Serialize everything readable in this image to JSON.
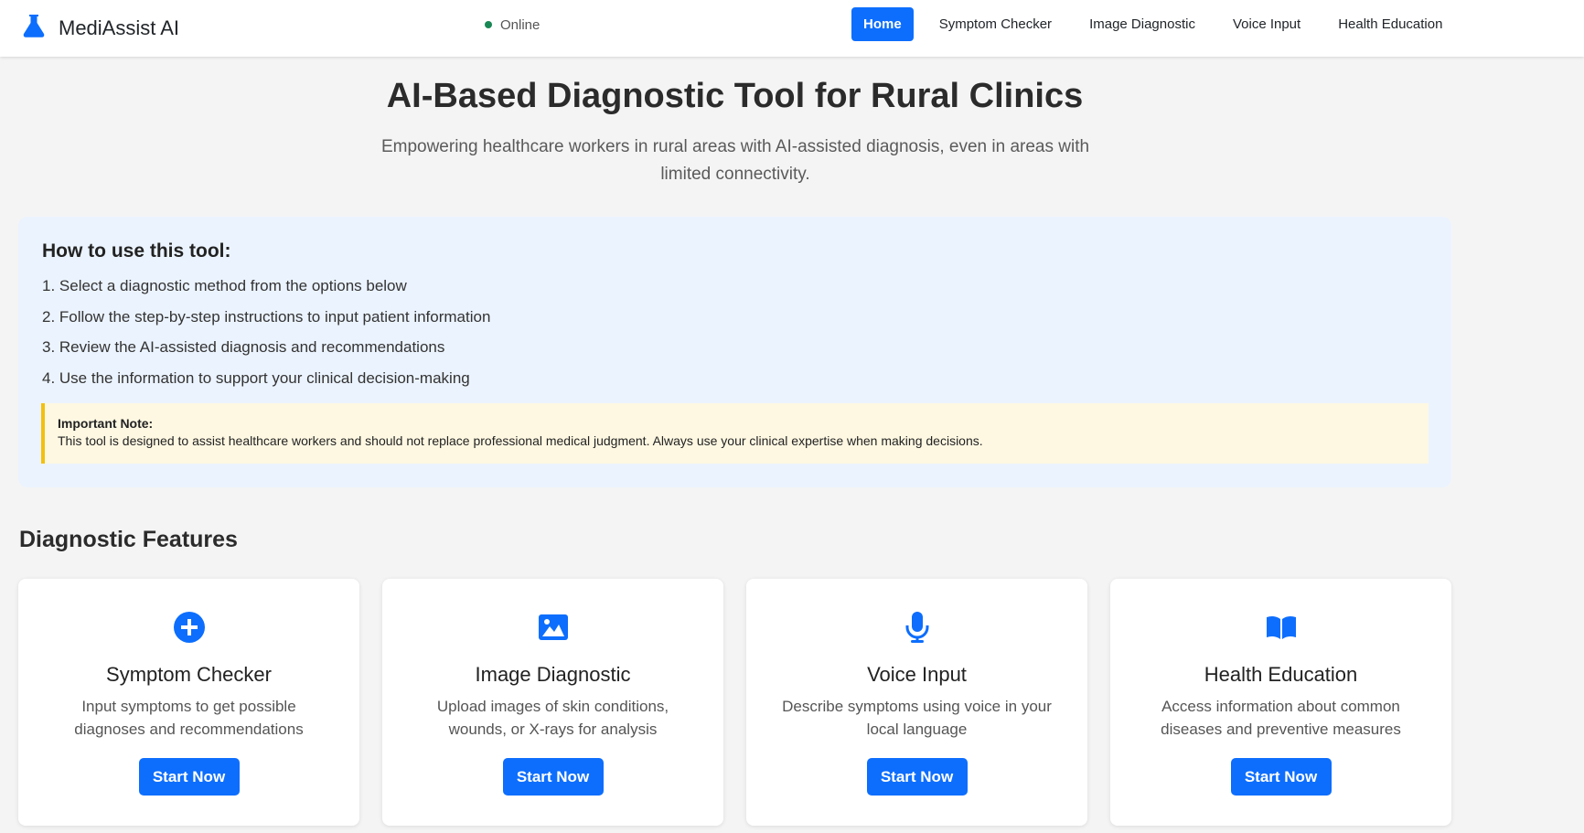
{
  "header": {
    "brand": "MediAssist AI",
    "brand_icon": "flask-icon",
    "status": "Online",
    "status_color": "#198754",
    "nav": [
      {
        "label": "Home",
        "active": true
      },
      {
        "label": "Symptom Checker"
      },
      {
        "label": "Image Diagnostic"
      },
      {
        "label": "Voice Input"
      },
      {
        "label": "Health Education"
      }
    ]
  },
  "hero": {
    "title": "AI-Based Diagnostic Tool for Rural Clinics",
    "subtitle": "Empowering healthcare workers in rural areas with AI-assisted diagnosis, even in areas with limited connectivity."
  },
  "howto": {
    "title": "How to use this tool:",
    "steps": [
      "1. Select a diagnostic method from the options below",
      "2. Follow the step-by-step instructions to input patient information",
      "3. Review the AI-assisted diagnosis and recommendations",
      "4. Use the information to support your clinical decision-making"
    ],
    "note_title": "Important Note:",
    "note_text": "This tool is designed to assist healthcare workers and should not replace professional medical judgment. Always use your clinical expertise when making decisions."
  },
  "features": {
    "title": "Diagnostic Features",
    "cards": [
      {
        "icon": "plus-circle-icon",
        "title": "Symptom Checker",
        "desc": "Input symptoms to get possible diagnoses and recommendations",
        "button": "Start Now"
      },
      {
        "icon": "image-icon",
        "title": "Image Diagnostic",
        "desc": "Upload images of skin conditions, wounds, or X-rays for analysis",
        "button": "Start Now"
      },
      {
        "icon": "microphone-icon",
        "title": "Voice Input",
        "desc": "Describe symptoms using voice in your local language",
        "button": "Start Now"
      },
      {
        "icon": "book-icon",
        "title": "Health Education",
        "desc": "Access information about common diseases and preventive measures",
        "button": "Start Now"
      }
    ]
  },
  "colors": {
    "accent": "#0d6efd",
    "info_bg": "#ebf3fe",
    "note_bg": "#fef8e2",
    "note_border": "#f2c010"
  }
}
